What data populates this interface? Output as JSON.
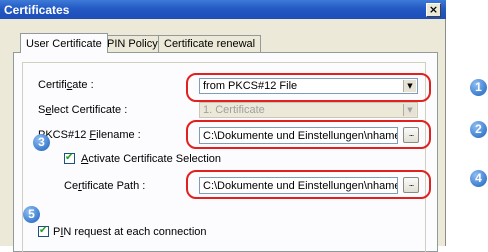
{
  "window": {
    "title": "Certificates",
    "close_glyph": "×"
  },
  "tabs": [
    {
      "label": "User Certificate",
      "active": true
    },
    {
      "label": "PIN Policy",
      "active": false
    },
    {
      "label": "Certificate renewal",
      "active": false
    }
  ],
  "form": {
    "certificate": {
      "pre": "Certifi",
      "acc": "c",
      "post": "ate :",
      "value": "from PKCS#12 File"
    },
    "select_certificate": {
      "pre": "S",
      "acc": "e",
      "post": "lect Certificate :",
      "value": "1. Certificate"
    },
    "pkcs_filename": {
      "pre": "PKCS#12 ",
      "acc": "F",
      "post": "ilename :",
      "value": "C:\\Dokumente und Einstellungen\\nhamel",
      "browse": "..."
    },
    "activate_selection": {
      "acc": "A",
      "post": "ctivate Certificate Selection",
      "checked": true
    },
    "certificate_path": {
      "pre": "Ce",
      "acc": "r",
      "post": "tificate Path :",
      "value": "C:\\Dokumente und Einstellungen\\nhamel",
      "browse": "..."
    },
    "pin_request": {
      "pre": "P",
      "acc": "I",
      "post": "N request at each connection",
      "checked": true
    }
  },
  "badges": [
    "1",
    "2",
    "3",
    "4",
    "5"
  ],
  "colors": {
    "highlight": "#e0211e",
    "badge": "#3c7dce",
    "titlebar": "#2459c4"
  }
}
